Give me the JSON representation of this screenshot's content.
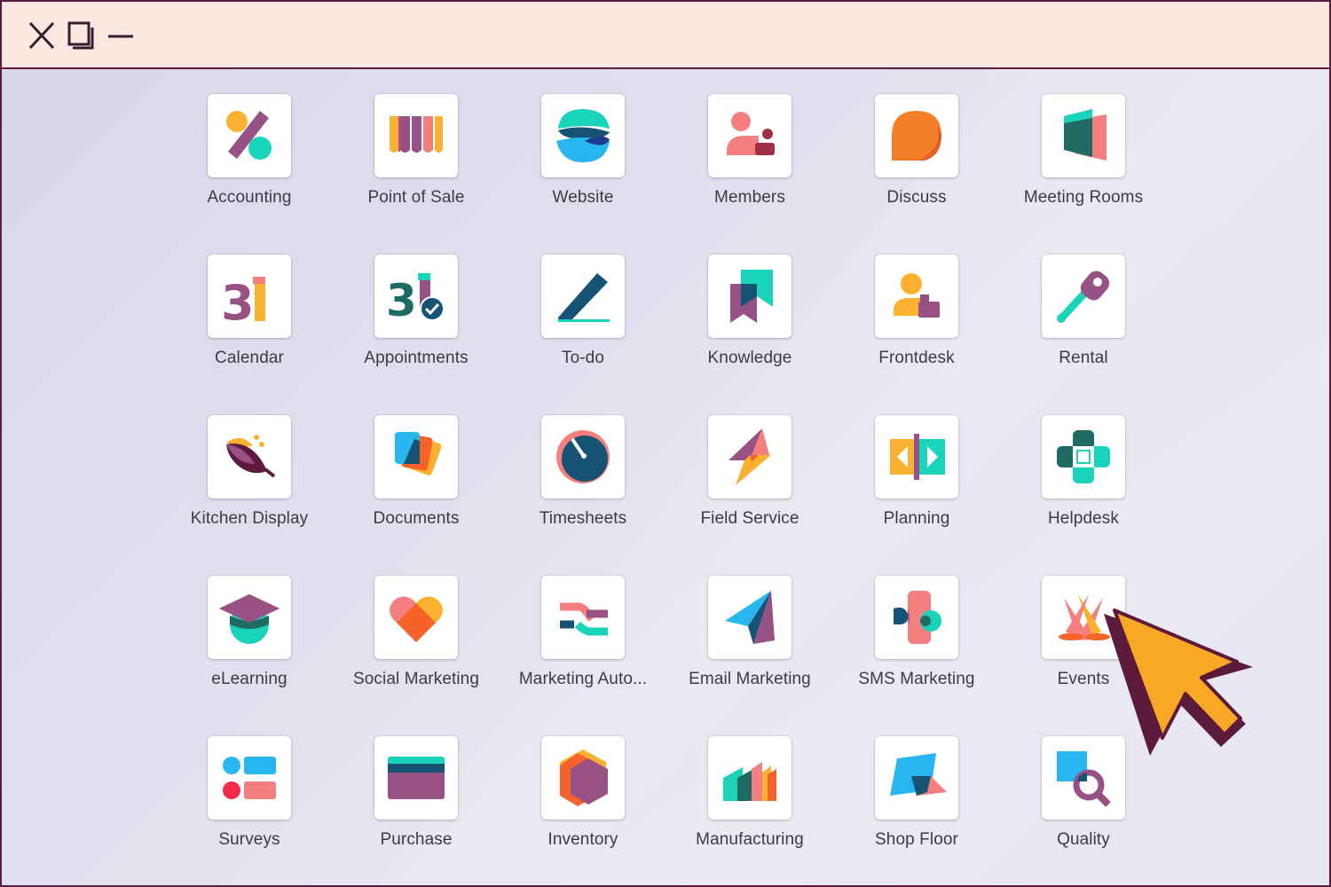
{
  "window": {
    "controls": [
      {
        "name": "close",
        "icon": "close-icon"
      },
      {
        "name": "restore",
        "icon": "restore-icon"
      },
      {
        "name": "minimize",
        "icon": "minimize-icon"
      }
    ],
    "colors": {
      "frame": "#5c1a3c",
      "titlebar": "#fbe9e1",
      "background": "#e3e1ee"
    }
  },
  "apps": [
    {
      "label": "Accounting",
      "icon": "accounting-icon"
    },
    {
      "label": "Point of Sale",
      "icon": "point-of-sale-icon"
    },
    {
      "label": "Website",
      "icon": "website-icon"
    },
    {
      "label": "Members",
      "icon": "members-icon"
    },
    {
      "label": "Discuss",
      "icon": "discuss-icon"
    },
    {
      "label": "Meeting Rooms",
      "icon": "meeting-rooms-icon"
    },
    {
      "label": "Calendar",
      "icon": "calendar-icon"
    },
    {
      "label": "Appointments",
      "icon": "appointments-icon"
    },
    {
      "label": "To-do",
      "icon": "todo-icon"
    },
    {
      "label": "Knowledge",
      "icon": "knowledge-icon"
    },
    {
      "label": "Frontdesk",
      "icon": "frontdesk-icon"
    },
    {
      "label": "Rental",
      "icon": "rental-icon"
    },
    {
      "label": "Kitchen Display",
      "icon": "kitchen-display-icon"
    },
    {
      "label": "Documents",
      "icon": "documents-icon"
    },
    {
      "label": "Timesheets",
      "icon": "timesheets-icon"
    },
    {
      "label": "Field Service",
      "icon": "field-service-icon"
    },
    {
      "label": "Planning",
      "icon": "planning-icon"
    },
    {
      "label": "Helpdesk",
      "icon": "helpdesk-icon"
    },
    {
      "label": "eLearning",
      "icon": "elearning-icon"
    },
    {
      "label": "Social Marketing",
      "icon": "social-marketing-icon"
    },
    {
      "label": "Marketing Auto...",
      "icon": "marketing-automation-icon"
    },
    {
      "label": "Email Marketing",
      "icon": "email-marketing-icon"
    },
    {
      "label": "SMS Marketing",
      "icon": "sms-marketing-icon"
    },
    {
      "label": "Events",
      "icon": "events-icon"
    },
    {
      "label": "Surveys",
      "icon": "surveys-icon"
    },
    {
      "label": "Purchase",
      "icon": "purchase-icon"
    },
    {
      "label": "Inventory",
      "icon": "inventory-icon"
    },
    {
      "label": "Manufacturing",
      "icon": "manufacturing-icon"
    },
    {
      "label": "Shop Floor",
      "icon": "shop-floor-icon"
    },
    {
      "label": "Quality",
      "icon": "quality-icon"
    }
  ],
  "cursor": {
    "icon": "mouse-pointer-icon",
    "color": "#f9a825",
    "outline": "#5c1a3c"
  }
}
